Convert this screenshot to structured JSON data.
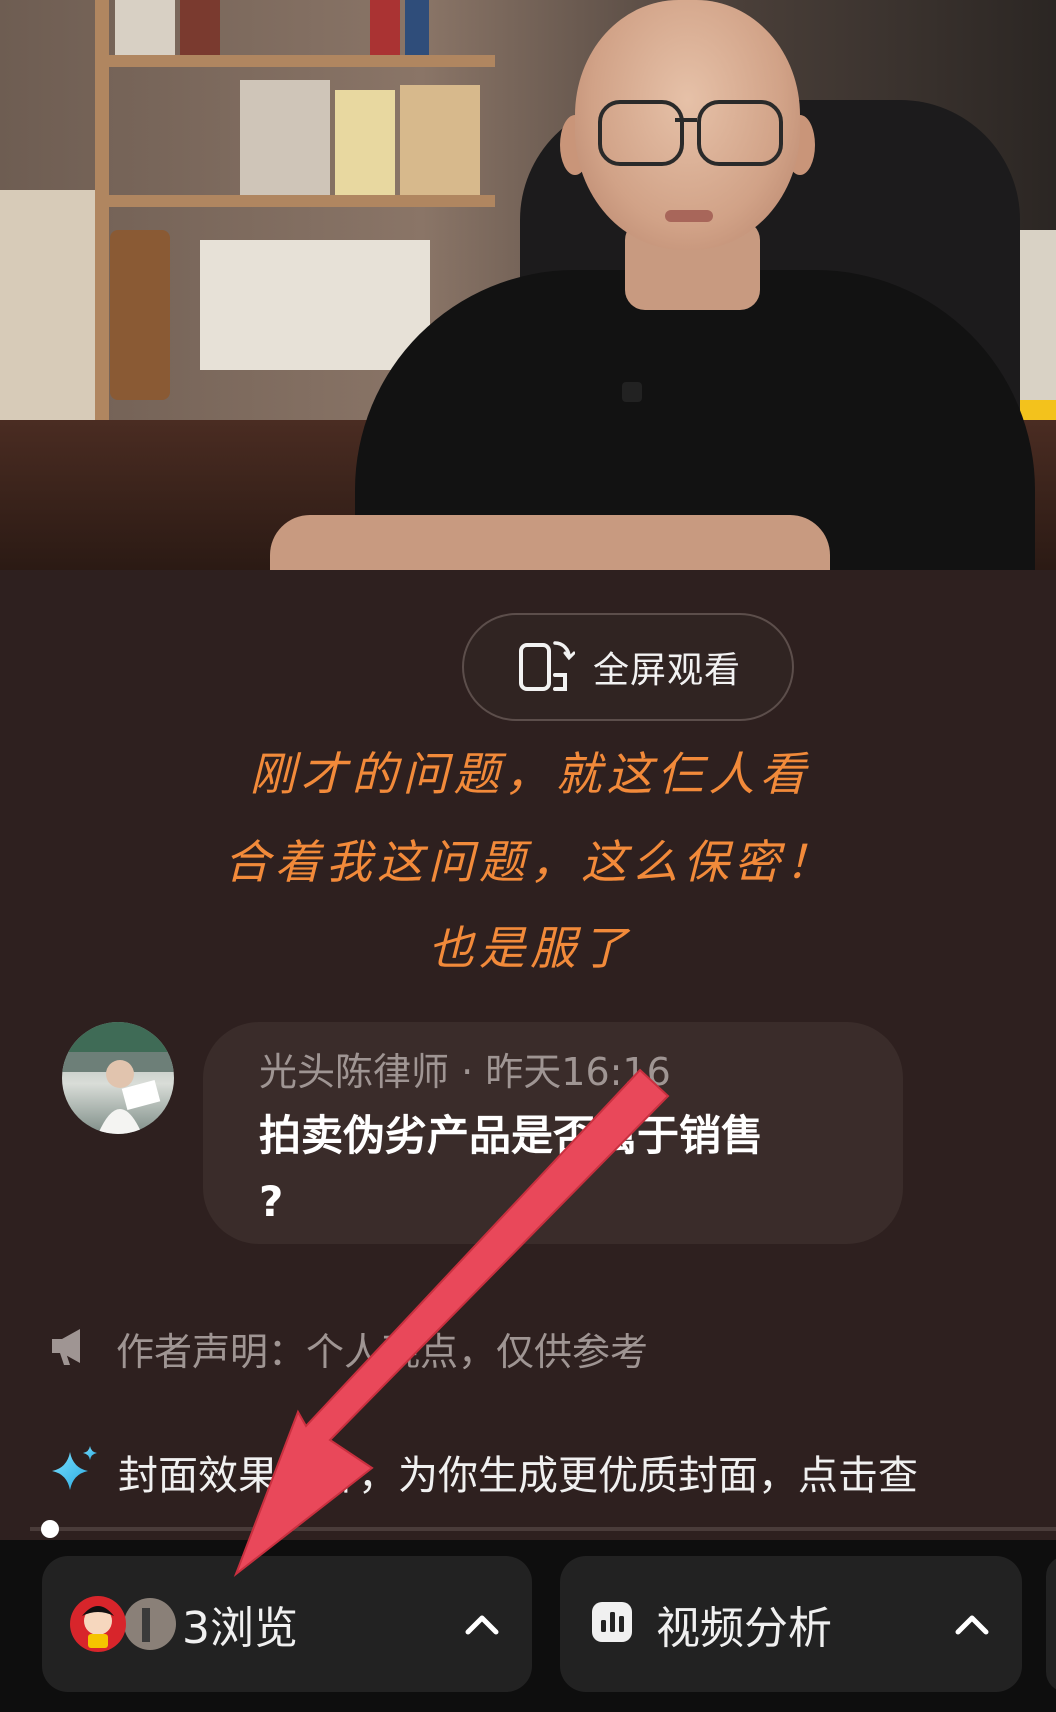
{
  "video": {
    "fullscreen_label": "全屏观看"
  },
  "caption": {
    "lines": [
      "刚才的问题，就这仨人看",
      "合着我这问题，这么保密！",
      "也是服了"
    ]
  },
  "post": {
    "author": "光头陈律师",
    "separator": " · ",
    "time": "昨天16:16",
    "text_line1": "拍卖伪劣产品是否属于销售",
    "text_line2": "?"
  },
  "statement": {
    "text": "作者声明：个人观点，仅供参考",
    "icon": "megaphone-icon"
  },
  "cover_tip": {
    "text": "封面效果提升，为你生成更优质封面，点击查",
    "icon": "sparkle-icon"
  },
  "progress": {
    "value": 0.01
  },
  "bottom_bar": {
    "views_label": "3浏览",
    "analysis_label": "视频分析"
  },
  "colors": {
    "background": "#2e201f",
    "caption": "#f28a3a",
    "arrow": "#e9485a",
    "sparkle": "#4fc3f7"
  }
}
